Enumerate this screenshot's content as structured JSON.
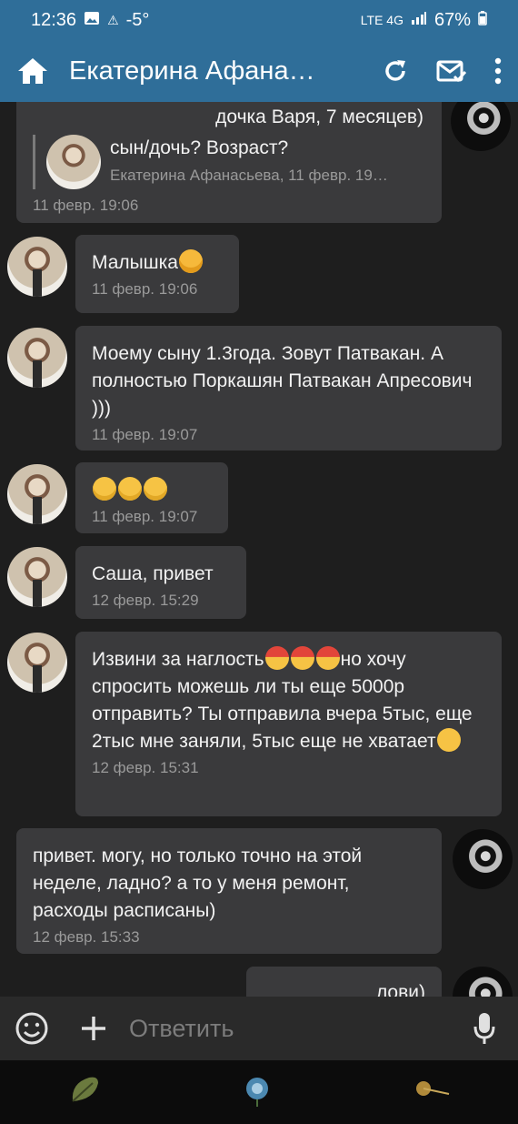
{
  "status": {
    "time": "12:36",
    "temp": "-5°",
    "network": "LTE 4G",
    "battery": "67%"
  },
  "appbar": {
    "title": "Екатерина Афана…",
    "icons": [
      "home-icon",
      "refresh-icon",
      "mark-read-icon",
      "more-icon"
    ]
  },
  "messages": [
    {
      "id": "m1",
      "text": "дочка Варя, 7 месяцев)",
      "quote_text": "сын/дочь? Возраст?",
      "quote_author": "Екатерина Афанасьева, 11 февр. 19…",
      "time": "11 февр. 19:06"
    },
    {
      "id": "m2",
      "text": "Малышка",
      "time": "11 февр. 19:06"
    },
    {
      "id": "m3",
      "text": "Моему сыну 1.3года. Зовут Патвакан. А полностью Поркашян Патвакан Апресович )))",
      "time": "11 февр. 19:07"
    },
    {
      "id": "m4",
      "text": "",
      "time": "11 февр. 19:07"
    },
    {
      "id": "m5",
      "text": "Саша, привет",
      "time": "12 февр. 15:29"
    },
    {
      "id": "m6",
      "text_a": "Извини за наглость",
      "text_b": "но хочу спросить можешь ли ты еще 5000р отправить? Ты отправила вчера 5тыс, еще 2тыс мне заняли, 5тыс еще не хватает",
      "time": "12 февр. 15:31"
    },
    {
      "id": "m7",
      "text": "привет. могу, но только точно на этой неделе, ладно? а то у меня ремонт, расходы расписаны)",
      "time": "12 февр. 15:33"
    },
    {
      "id": "m8",
      "text": "лови)"
    }
  ],
  "input": {
    "placeholder": "Ответить"
  }
}
